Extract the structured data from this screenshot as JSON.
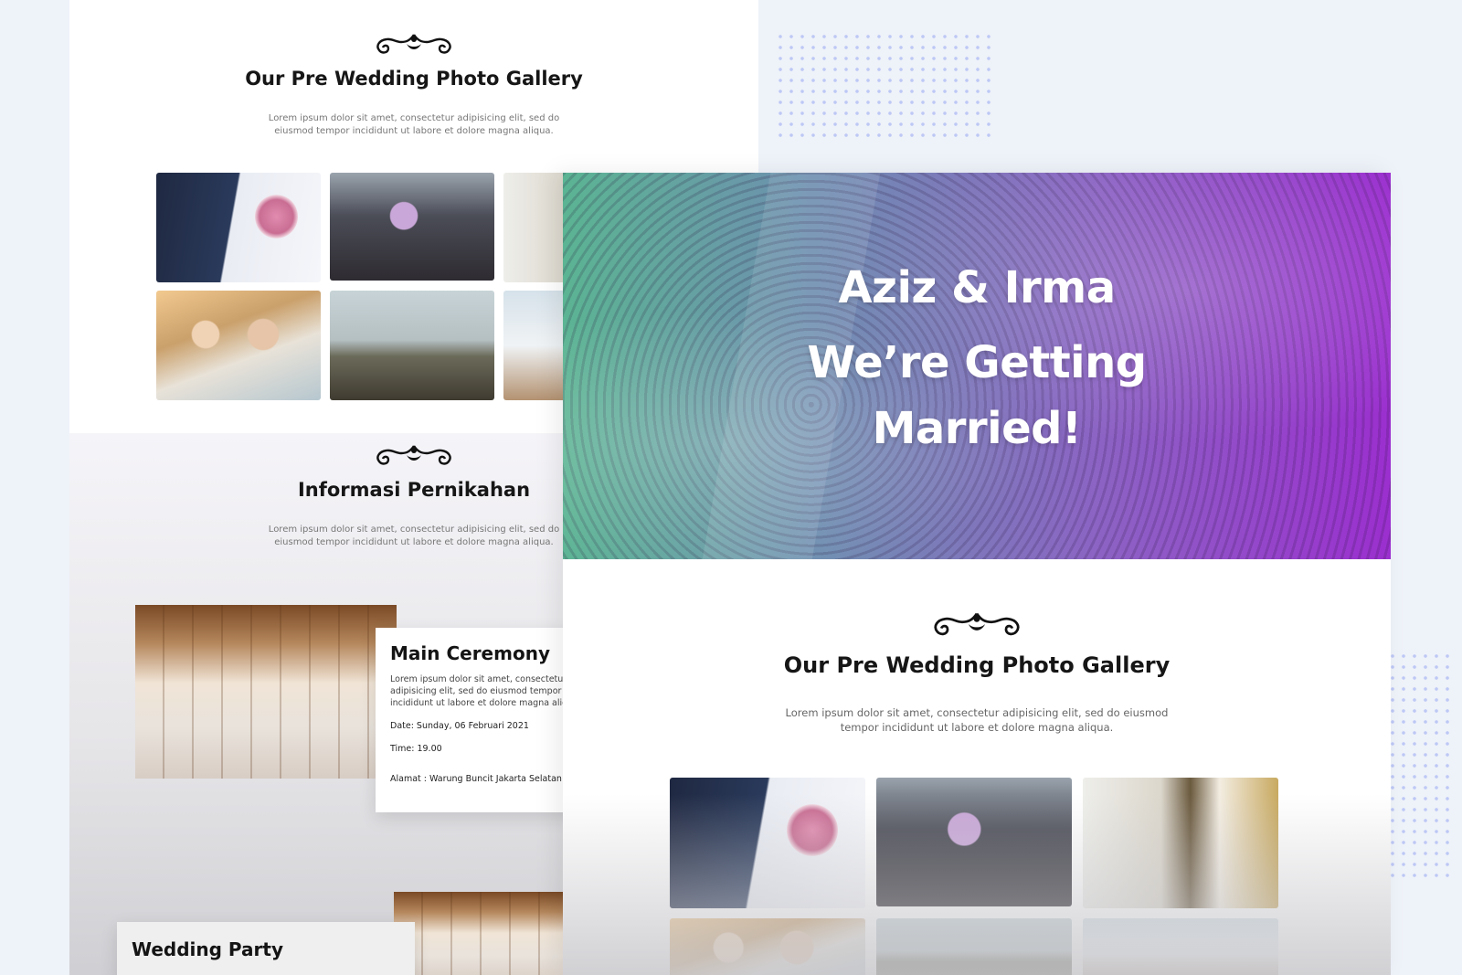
{
  "back_page": {
    "gallery": {
      "title": "Our Pre Wedding Photo Gallery",
      "description": "Lorem ipsum dolor sit amet, consectetur adipisicing elit, sed do eiusmod tempor incididunt ut labore et dolore magna aliqua."
    },
    "info": {
      "title": "Informasi Pernikahan",
      "description": "Lorem ipsum dolor sit amet, consectetur adipisicing elit, sed do eiusmod tempor incididunt ut labore et dolore magna aliqua."
    },
    "main_ceremony": {
      "title": "Main Ceremony",
      "description": "Lorem ipsum dolor sit amet, consectetur adipisicing elit, sed do eiusmod tempor incididunt ut labore et dolore magna aliqua.",
      "date": "Date: Sunday, 06 Februari 2021",
      "time": "Time: 19.00",
      "address": "Alamat : Warung Buncit Jakarta Selatan"
    },
    "wedding_party": {
      "title": "Wedding Party"
    }
  },
  "front_page": {
    "hero": {
      "names": "Aziz & Irma",
      "line2": "We’re Getting",
      "line3": "Married!"
    },
    "gallery": {
      "title": "Our Pre Wedding Photo Gallery",
      "description": "Lorem ipsum dolor sit amet, consectetur adipisicing elit, sed do eiusmod tempor incididunt ut labore et dolore magna aliqua."
    }
  }
}
